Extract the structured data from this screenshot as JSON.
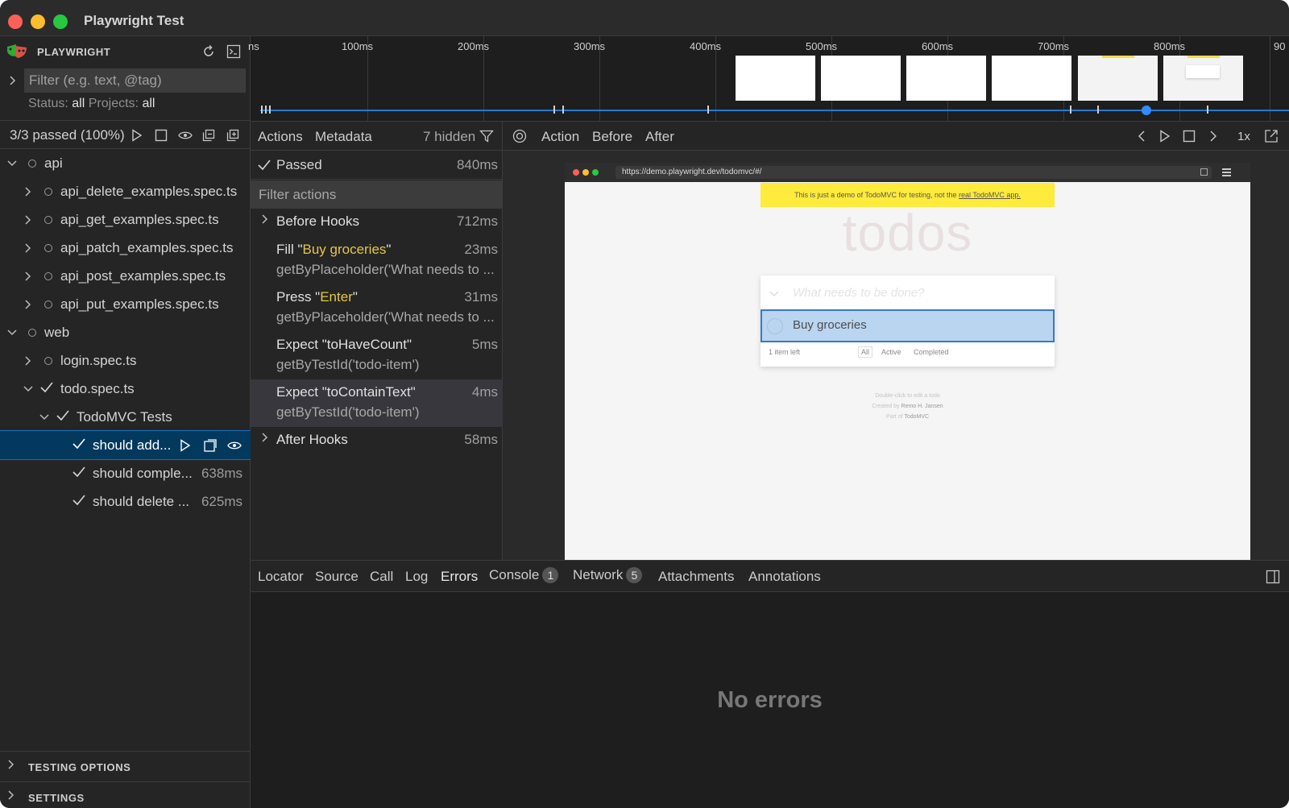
{
  "window": {
    "title": "Playwright Test"
  },
  "sidebar": {
    "brand": "PLAYWRIGHT",
    "filter_placeholder": "Filter (e.g. text, @tag)",
    "status_label": "Status:",
    "status_value": "all",
    "projects_label": "Projects:",
    "projects_value": "all",
    "pass_summary": "3/3 passed (100%)",
    "tree": {
      "api": "api",
      "api_delete": "api_delete_examples.spec.ts",
      "api_get": "api_get_examples.spec.ts",
      "api_patch": "api_patch_examples.spec.ts",
      "api_post": "api_post_examples.spec.ts",
      "api_put": "api_put_examples.spec.ts",
      "web": "web",
      "login": "login.spec.ts",
      "todo": "todo.spec.ts",
      "suite": "TodoMVC Tests",
      "test1": "should add...",
      "test2": "should comple...",
      "test2_dur": "638ms",
      "test3": "should delete ...",
      "test3_dur": "625ms"
    },
    "testing_options": "TESTING OPTIONS",
    "settings": "SETTINGS"
  },
  "timeline": {
    "ticks": [
      "ns",
      "100ms",
      "200ms",
      "300ms",
      "400ms",
      "500ms",
      "600ms",
      "700ms",
      "800ms",
      "90"
    ]
  },
  "actions": {
    "tab_actions": "Actions",
    "tab_metadata": "Metadata",
    "hidden": "7 hidden",
    "passed_label": "Passed",
    "passed_duration": "840ms",
    "filter_placeholder": "Filter actions",
    "items": [
      {
        "title": "Before Hooks",
        "duration": "712ms"
      },
      {
        "pre": "Fill \"",
        "hl": "Buy groceries",
        "post": "\"",
        "duration": "23ms",
        "sub": "getByPlaceholder('What needs to ..."
      },
      {
        "pre": "Press \"",
        "hl": "Enter",
        "post": "\"",
        "duration": "31ms",
        "sub": "getByPlaceholder('What needs to ..."
      },
      {
        "title": "Expect \"toHaveCount\"",
        "duration": "5ms",
        "sub": "getByTestId('todo-item')"
      },
      {
        "title": "Expect \"toContainText\"",
        "duration": "4ms",
        "sub": "getByTestId('todo-item')"
      },
      {
        "title": "After Hooks",
        "duration": "58ms"
      }
    ]
  },
  "snapshot": {
    "tab_action": "Action",
    "tab_before": "Before",
    "tab_after": "After",
    "speed": "1x",
    "url": "https://demo.playwright.dev/todomvc/#/",
    "banner_text": "This is just a demo of TodoMVC for testing, not the",
    "banner_link": "real TodoMVC app.",
    "heading": "todos",
    "new_todo_placeholder": "What needs to be done?",
    "todo_item": "Buy groceries",
    "items_left": "1 item left",
    "filter_all": "All",
    "filter_active": "Active",
    "filter_completed": "Completed",
    "info1": "Double-click to edit a todo",
    "info2_pre": "Created by",
    "info2_name": "Remo H. Jansen",
    "info3_pre": "Part of",
    "info3_name": "TodoMVC"
  },
  "details": {
    "tabs": {
      "locator": "Locator",
      "source": "Source",
      "call": "Call",
      "log": "Log",
      "errors": "Errors",
      "console": "Console",
      "console_count": "1",
      "network": "Network",
      "network_count": "5",
      "attachments": "Attachments",
      "annotations": "Annotations"
    },
    "empty_message": "No errors"
  }
}
